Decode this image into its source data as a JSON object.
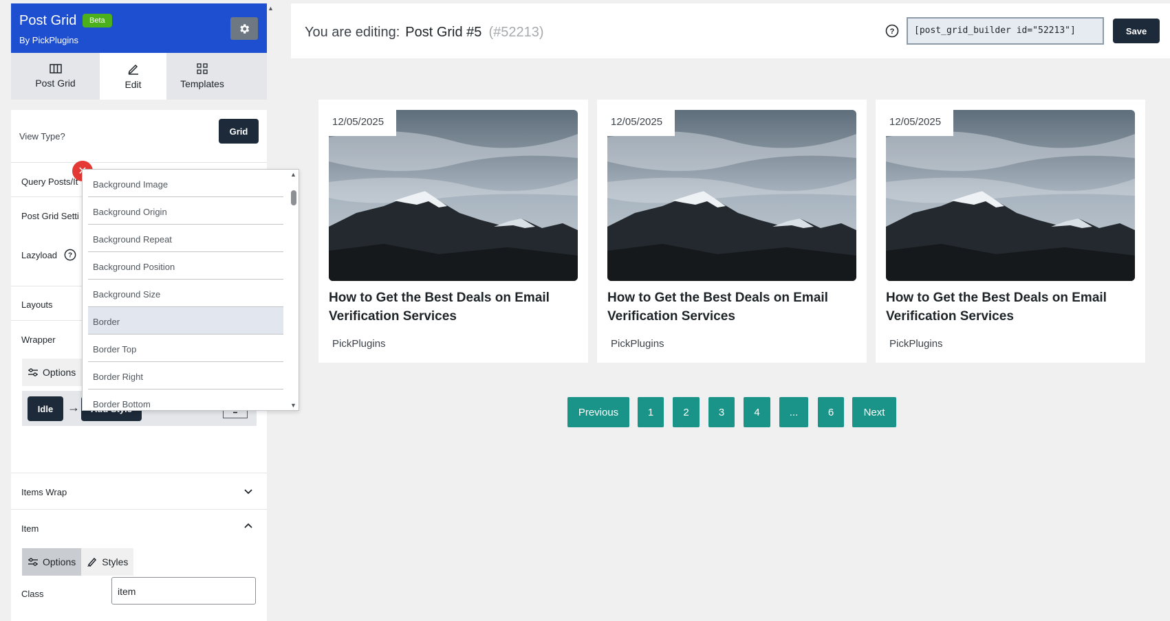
{
  "sidebar": {
    "brand_title": "Post Grid",
    "beta_badge": "Beta",
    "brand_by": "By PickPlugins",
    "tabs": [
      {
        "label": "Post Grid",
        "icon": "columns-icon"
      },
      {
        "label": "Edit",
        "icon": "pencil-icon"
      },
      {
        "label": "Templates",
        "icon": "grid-icon"
      }
    ],
    "view_type_label": "View Type?",
    "view_type_value": "Grid",
    "sections": {
      "query": "Query Posts/It",
      "settings": "Post Grid Setti",
      "lazyload": "Lazyload",
      "layouts": "Layouts",
      "wrapper": "Wrapper",
      "items_wrap": "Items Wrap",
      "item": "Item"
    },
    "wrapper_options": "Options",
    "idle_label": "Idle",
    "add_style_label": "Add Style",
    "item_options": "Options",
    "item_styles": "Styles",
    "class_label": "Class",
    "class_value": "item"
  },
  "dropdown": {
    "options": [
      "Background Image",
      "Background Origin",
      "Background Repeat",
      "Background Position",
      "Background Size",
      "Border",
      "Border Top",
      "Border Right",
      "Border Bottom"
    ],
    "highlighted": "Border"
  },
  "topbar": {
    "editing_label": "You are editing:",
    "post_name": "Post Grid #5",
    "post_id": "(#52213)",
    "shortcode": "[post_grid_builder id=\"52213\"]",
    "save_label": "Save"
  },
  "cards": [
    {
      "date": "12/05/2025",
      "title": "How to Get the Best Deals on Email Verification Services",
      "author": "PickPlugins"
    },
    {
      "date": "12/05/2025",
      "title": "How to Get the Best Deals on Email Verification Services",
      "author": "PickPlugins"
    },
    {
      "date": "12/05/2025",
      "title": "How to Get the Best Deals on Email Verification Services",
      "author": "PickPlugins"
    }
  ],
  "pagination": [
    "Previous",
    "1",
    "2",
    "3",
    "4",
    "...",
    "6",
    "Next"
  ],
  "colors": {
    "brand": "#1f4fd1",
    "beta": "#4caf1c",
    "pagination": "#1a9488",
    "dark_button": "#1d2a3a",
    "close": "#e53935"
  }
}
